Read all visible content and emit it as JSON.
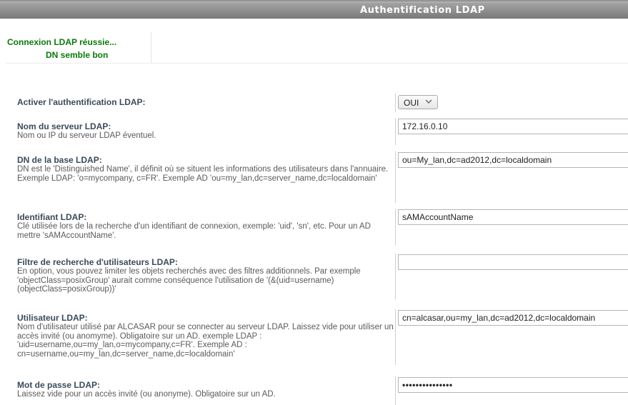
{
  "header": {
    "title": "Authentification LDAP"
  },
  "status": {
    "line1": "Connexion LDAP réussie...",
    "line2": "DN semble bon"
  },
  "fields": {
    "activate": {
      "label": "Activer l'authentification LDAP:",
      "selected": "OUI"
    },
    "server": {
      "label": "Nom du serveur LDAP:",
      "desc": "Nom ou IP du serveur LDAP éventuel.",
      "value": "172.16.0.10"
    },
    "base_dn": {
      "label": "DN de la base LDAP:",
      "desc": "DN est le 'Distinguished Name', il définit où se situent les informations des utilisateurs dans l'annuaire. Exemple LDAP: 'o=mycompany, c=FR'. Exemple AD 'ou=my_lan,dc=server_name,dc=localdomain'",
      "value": "ou=My_lan,dc=ad2012,dc=localdomain"
    },
    "identifier": {
      "label": "Identifiant LDAP:",
      "desc": "Clé utilisée lors de la recherche d'un identifiant de connexion, exemple: 'uid', 'sn', etc. Pour un AD mettre 'sAMAccountName'.",
      "value": "sAMAccountName"
    },
    "filter": {
      "label": "Filtre de recherche d'utilisateurs LDAP:",
      "desc": "En option, vous pouvez limiter les objets recherchés avec des filtres additionnels. Par exemple 'objectClass=posixGroup' aurait comme conséquence l'utilisation de '(&(uid=username)(objectClass=posixGroup))'",
      "value": ""
    },
    "user": {
      "label": "Utilisateur LDAP:",
      "desc": "Nom d'utilisateur utilisé par ALCASAR pour se connecter au serveur LDAP. Laissez vide pour utiliser un accès invité (ou anomyme). Obligatoire sur un AD. exemple LDAP : 'uid=username,ou=my_lan,o=mycompany,c=FR'. Exemple AD : cn=username,ou=my_lan,dc=server_name,dc=localdomain'",
      "value": "cn=alcasar,ou=my_lan,dc=ad2012,dc=localdomain"
    },
    "password": {
      "label": "Mot de passe LDAP:",
      "desc": "Laissez vide pour un accès invité (ou anonyme). Obligatoire sur un AD.",
      "value": "•••••••••••••••"
    }
  },
  "icons": {
    "select_arrow": "chevron-down-icon"
  }
}
